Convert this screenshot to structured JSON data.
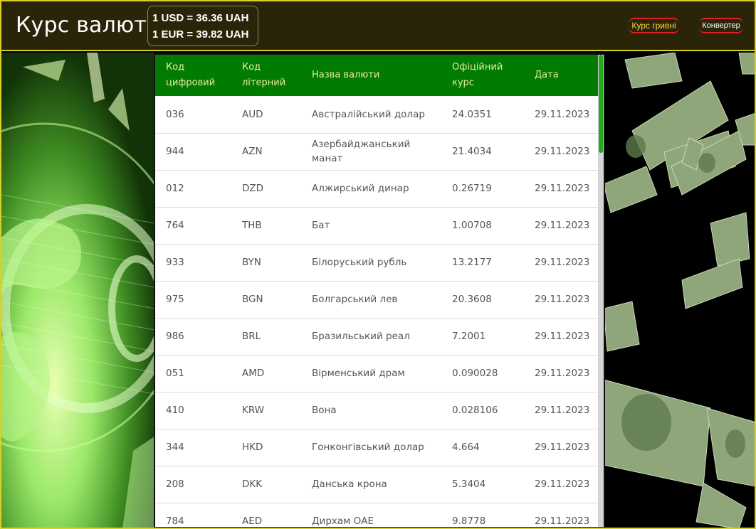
{
  "header": {
    "title": "Курс валют",
    "usd_rate": "1 USD = 36.36 UAH",
    "eur_rate": "1 EUR = 39.82 UAH",
    "nav": {
      "hryvnia_label": "Курс гривні",
      "converter_label": "Конвертер"
    }
  },
  "table": {
    "columns": {
      "digital_code": [
        "Код",
        "цифровий"
      ],
      "letter_code": [
        "Код",
        "літерний"
      ],
      "name": [
        "Назва валюти"
      ],
      "official_rate": [
        "Офіційний",
        "курс"
      ],
      "date": [
        "Дата"
      ]
    },
    "rows": [
      {
        "digital": "036",
        "letter": "AUD",
        "name": "Австралійський долар",
        "rate": "24.0351",
        "date": "29.11.2023"
      },
      {
        "digital": "944",
        "letter": "AZN",
        "name": "Азербайджанський манат",
        "rate": "21.4034",
        "date": "29.11.2023"
      },
      {
        "digital": "012",
        "letter": "DZD",
        "name": "Алжирський динар",
        "rate": "0.26719",
        "date": "29.11.2023"
      },
      {
        "digital": "764",
        "letter": "THB",
        "name": "Бат",
        "rate": "1.00708",
        "date": "29.11.2023"
      },
      {
        "digital": "933",
        "letter": "BYN",
        "name": "Білоруський рубль",
        "rate": "13.2177",
        "date": "29.11.2023"
      },
      {
        "digital": "975",
        "letter": "BGN",
        "name": "Болгарський лев",
        "rate": "20.3608",
        "date": "29.11.2023"
      },
      {
        "digital": "986",
        "letter": "BRL",
        "name": "Бразильський реал",
        "rate": "7.2001",
        "date": "29.11.2023"
      },
      {
        "digital": "051",
        "letter": "AMD",
        "name": "Вірменський драм",
        "rate": "0.090028",
        "date": "29.11.2023"
      },
      {
        "digital": "410",
        "letter": "KRW",
        "name": "Вона",
        "rate": "0.028106",
        "date": "29.11.2023"
      },
      {
        "digital": "344",
        "letter": "HKD",
        "name": "Гонконгівський долар",
        "rate": "4.664",
        "date": "29.11.2023"
      },
      {
        "digital": "208",
        "letter": "DKK",
        "name": "Данська крона",
        "rate": "5.3404",
        "date": "29.11.2023"
      },
      {
        "digital": "784",
        "letter": "AED",
        "name": "Дирхам ОАЕ",
        "rate": "9.8778",
        "date": "29.11.2023"
      }
    ]
  },
  "colors": {
    "header_bg": "#2a2408",
    "border_accent": "#d8d02a",
    "table_header_bg": "#027b03",
    "nav_underline": "#e02020",
    "scroll_thumb": "#22a91e"
  },
  "icons": {
    "left_background": "green-globe-illustration",
    "right_background": "flying-dollar-bills-illustration"
  }
}
